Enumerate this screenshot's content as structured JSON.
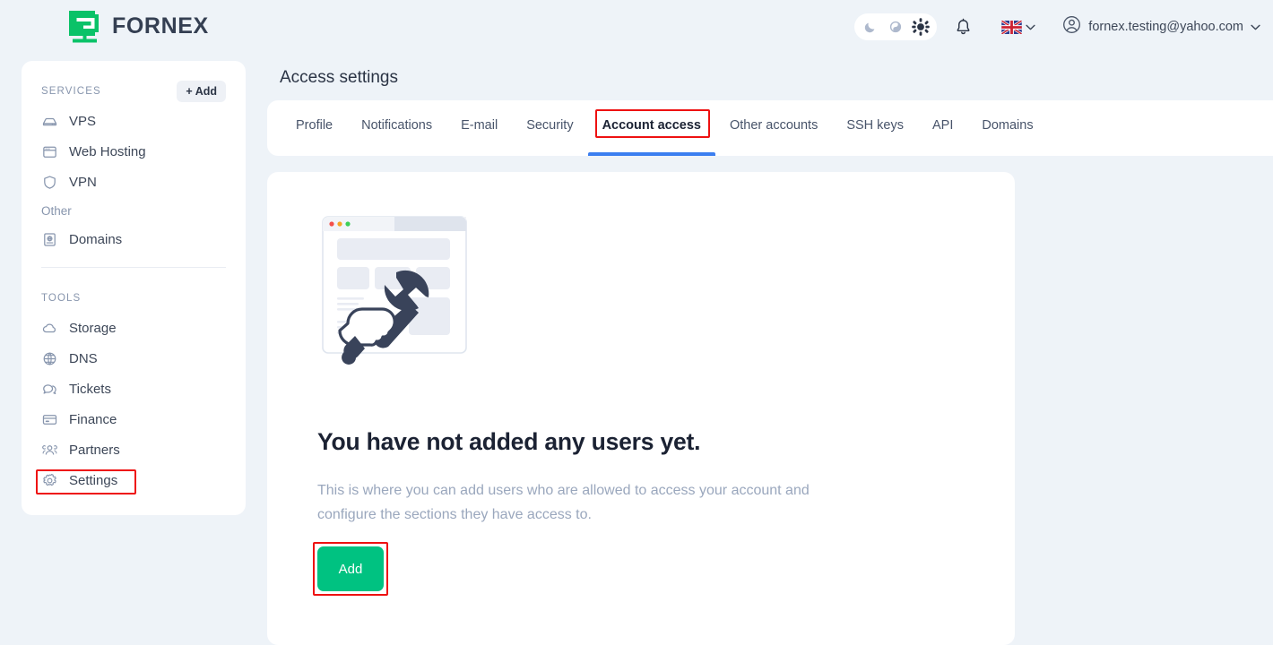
{
  "brand": {
    "name": "FORNEX",
    "logo_icon": "fornex-monitor-logo-icon",
    "green": "#00c281",
    "dark": "#343f52"
  },
  "topbar": {
    "theme_toggle": {
      "options": [
        {
          "icon": "moon-icon",
          "name": "dark-theme",
          "active": false
        },
        {
          "icon": "half-moon-contrast-icon",
          "name": "auto-theme",
          "active": false
        },
        {
          "icon": "sun-icon",
          "name": "light-theme",
          "active": true
        }
      ]
    },
    "notifications_icon": "bell-icon",
    "language": {
      "flag": "uk-flag-icon",
      "code": "EN",
      "chevron": "chevron-down-icon"
    },
    "user": {
      "avatar_icon": "user-circle-icon",
      "email": "fornex.testing@yahoo.com",
      "chevron": "chevron-down-icon"
    }
  },
  "sidebar": {
    "services": {
      "label": "SERVICES",
      "add_label": "+ Add",
      "items": [
        {
          "label": "VPS",
          "icon": "server-icon"
        },
        {
          "label": "Web Hosting",
          "icon": "browser-window-icon"
        },
        {
          "label": "VPN",
          "icon": "shield-icon"
        }
      ]
    },
    "other": {
      "label": "Other",
      "items": [
        {
          "label": "Domains",
          "icon": "domain-book-icon"
        }
      ]
    },
    "tools": {
      "label": "TOOLS",
      "items": [
        {
          "label": "Storage",
          "icon": "cloud-icon",
          "highlighted": false
        },
        {
          "label": "DNS",
          "icon": "globe-icon",
          "highlighted": false
        },
        {
          "label": "Tickets",
          "icon": "chat-bubbles-icon",
          "highlighted": false
        },
        {
          "label": "Finance",
          "icon": "credit-card-icon",
          "highlighted": false
        },
        {
          "label": "Partners",
          "icon": "people-group-icon",
          "highlighted": false
        },
        {
          "label": "Settings",
          "icon": "gear-icon",
          "highlighted": true
        }
      ]
    }
  },
  "main": {
    "page_title": "Access settings",
    "tabs": [
      {
        "label": "Profile",
        "active": false,
        "highlighted": false
      },
      {
        "label": "Notifications",
        "active": false,
        "highlighted": false
      },
      {
        "label": "E-mail",
        "active": false,
        "highlighted": false
      },
      {
        "label": "Security",
        "active": false,
        "highlighted": false
      },
      {
        "label": "Account access",
        "active": true,
        "highlighted": true
      },
      {
        "label": "Other accounts",
        "active": false,
        "highlighted": false
      },
      {
        "label": "SSH keys",
        "active": false,
        "highlighted": false
      },
      {
        "label": "API",
        "active": false,
        "highlighted": false
      },
      {
        "label": "Domains",
        "active": false,
        "highlighted": false
      }
    ],
    "empty_state": {
      "illustration_icon": "hand-holding-wrench-browser-illustration",
      "title": "You have not added any users yet.",
      "description": "This is where you can add users who are allowed to access your account and configure the sections they have access to.",
      "add_button_label": "Add",
      "add_button_color": "#00c281"
    }
  },
  "annotations": {
    "highlight_color": "#ee1111"
  }
}
